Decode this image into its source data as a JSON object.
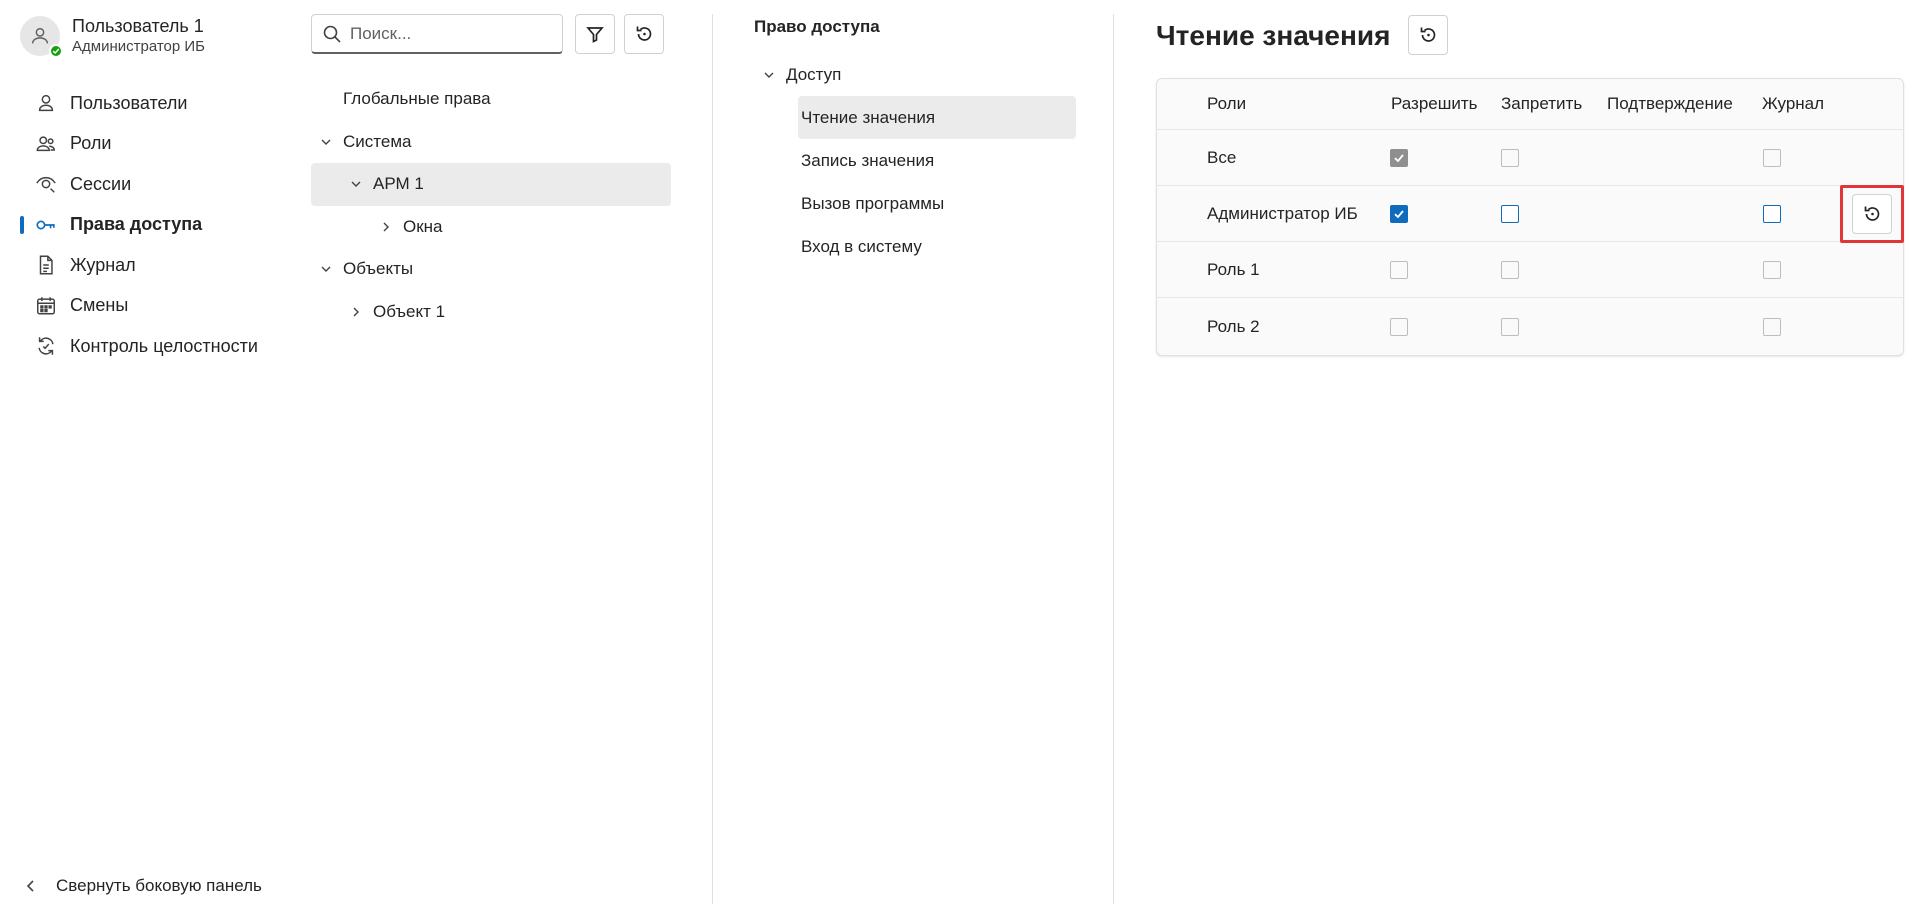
{
  "user": {
    "name": "Пользователь 1",
    "role": "Администратор ИБ",
    "status_color": "#13a10e"
  },
  "nav": {
    "items": [
      {
        "label": "Пользователи",
        "icon": "person-icon"
      },
      {
        "label": "Роли",
        "icon": "people-icon"
      },
      {
        "label": "Сессии",
        "icon": "eye-icon"
      },
      {
        "label": "Права доступа",
        "icon": "key-icon",
        "active": true
      },
      {
        "label": "Журнал",
        "icon": "document-icon"
      },
      {
        "label": "Смены",
        "icon": "calendar-icon"
      },
      {
        "label": "Контроль целостности",
        "icon": "sync-icon"
      }
    ],
    "collapse_label": "Свернуть боковую панель"
  },
  "tree": {
    "search_placeholder": "Поиск...",
    "items": [
      {
        "label": "Глобальные права"
      },
      {
        "label": "Система",
        "expanded": true
      },
      {
        "label": "АРМ 1",
        "expanded": true,
        "selected": true
      },
      {
        "label": "Окна",
        "expanded": false
      },
      {
        "label": "Объекты",
        "expanded": true
      },
      {
        "label": "Объект 1",
        "expanded": false
      }
    ]
  },
  "permissions": {
    "title": "Право доступа",
    "group": "Доступ",
    "items": [
      {
        "label": "Чтение значения",
        "selected": true
      },
      {
        "label": "Запись значения"
      },
      {
        "label": "Вызов программы"
      },
      {
        "label": "Вход в систему"
      }
    ]
  },
  "detail": {
    "title": "Чтение значения",
    "columns": [
      "Роли",
      "Разрешить",
      "Запретить",
      "Подтверждение",
      "Журнал"
    ],
    "rows": [
      {
        "role": "Все",
        "allow": true,
        "deny": false,
        "log": false,
        "disabled": true
      },
      {
        "role": "Администратор ИБ",
        "allow": true,
        "deny": false,
        "log": false,
        "disabled": false
      },
      {
        "role": "Роль 1",
        "allow": false,
        "deny": false,
        "log": false,
        "disabled": true
      },
      {
        "role": "Роль 2",
        "allow": false,
        "deny": false,
        "log": false,
        "disabled": true
      }
    ]
  },
  "colors": {
    "accent": "#0f6cbd",
    "selection": "#ebebeb",
    "highlight_border": "#e0363a"
  }
}
